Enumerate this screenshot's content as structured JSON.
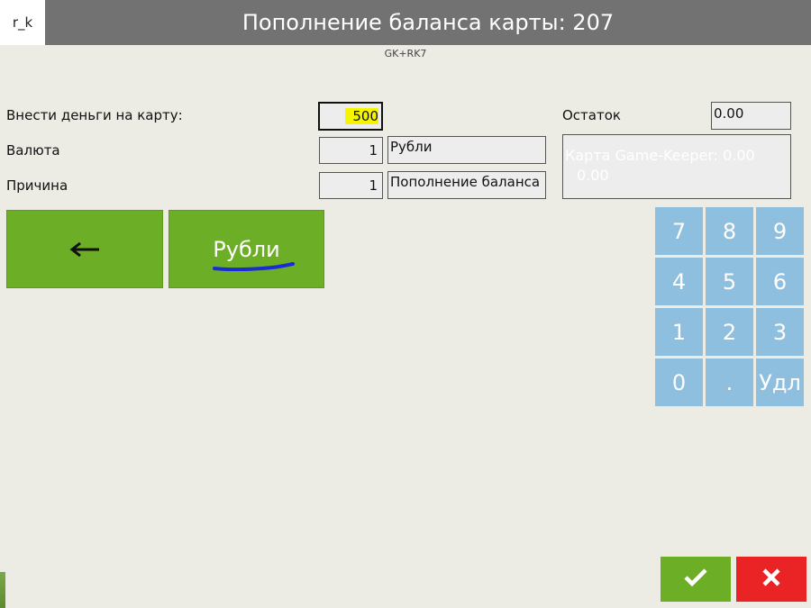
{
  "header": {
    "logo_text": "r_k",
    "title": "Пополнение баланса карты: 207",
    "subtitle": "GK+RK7",
    "bar_color": "#727272"
  },
  "form": {
    "amount_label": "Внести деньги на карту:",
    "amount_value": "500",
    "currency_label": "Валюта",
    "currency_code": "1",
    "currency_name": "Рубли",
    "reason_label": "Причина",
    "reason_code": "1",
    "reason_name": "Пополнение баланса"
  },
  "balance": {
    "label": "Остаток",
    "value": "0.00",
    "card_line1": "Карта Game-Keeper: 0.00",
    "card_line2": "0.00"
  },
  "actions": {
    "back_icon": "arrow-left-icon",
    "currency_button": "Рубли"
  },
  "keypad": {
    "keys": [
      "7",
      "8",
      "9",
      "4",
      "5",
      "6",
      "1",
      "2",
      "3",
      "0",
      ".",
      "Удл"
    ],
    "key_color": "#8fbfdf"
  },
  "footer": {
    "ok_icon": "check-icon",
    "cancel_icon": "close-icon",
    "ok_color": "#6cae26",
    "cancel_color": "#ea2424"
  }
}
